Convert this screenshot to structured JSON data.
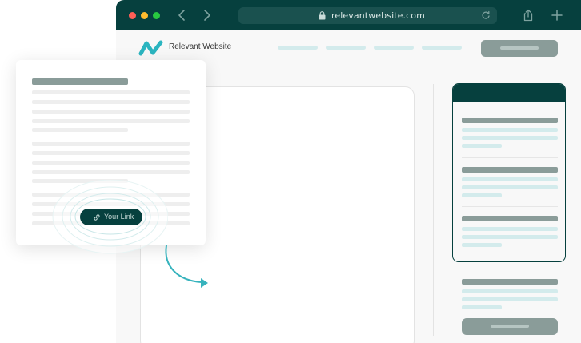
{
  "browser": {
    "url": "relevantwebsite.com",
    "colors": {
      "chrome": "#06403e",
      "urlbar": "#1a514f"
    },
    "icons": [
      "back-arrow-icon",
      "forward-arrow-icon",
      "lock-icon",
      "reload-icon",
      "share-icon",
      "plus-icon"
    ]
  },
  "site": {
    "name": "Relevant Website",
    "logo_icon": "relevant-logo-icon",
    "accent": "#2bb5c0"
  },
  "document": {
    "link_label": "Your Link",
    "link_icon": "link-icon"
  },
  "colors": {
    "dark_teal": "#06403e",
    "placeholder_gray": "#8a9c99",
    "placeholder_light": "#d3ebec",
    "arrow": "#37b3bd"
  }
}
